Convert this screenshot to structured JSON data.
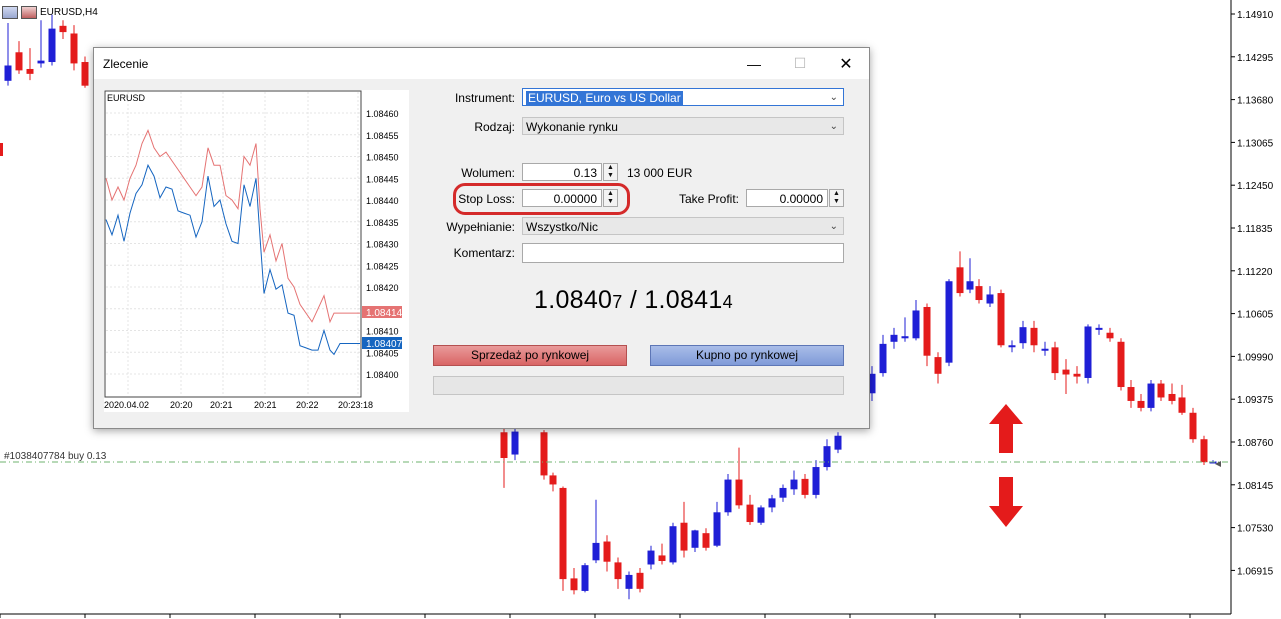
{
  "main_chart": {
    "symbol_label": "EURUSD,H4",
    "order_line_label": "#1038407784 buy 0.13",
    "price_ticks": [
      "1.14910",
      "1.14295",
      "1.13680",
      "1.13065",
      "1.12450",
      "1.11835",
      "1.11220",
      "1.10605",
      "1.09990",
      "1.09375",
      "1.08760",
      "1.08145",
      "1.07530",
      "1.06915"
    ],
    "colors": {
      "bull": "#1f1fd6",
      "bear": "#e41b1b",
      "order_line": "#6fb36f"
    },
    "up_arrow_icon": "arrow-up-icon",
    "down_arrow_icon": "arrow-down-icon"
  },
  "dialog": {
    "title": "Zlecenie",
    "minimize_icon": "minimize-icon",
    "maximize_icon": "maximize-icon",
    "close_icon": "close-icon",
    "mini_chart": {
      "symbol": "EURUSD",
      "price_ticks": [
        "1.08460",
        "1.08455",
        "1.08450",
        "1.08445",
        "1.08440",
        "1.08435",
        "1.08430",
        "1.08425",
        "1.08420",
        "1.08415",
        "1.08410",
        "1.08405",
        "1.08400"
      ],
      "time_ticks": [
        "2020.04.02",
        "20:20",
        "20:21",
        "20:21",
        "20:22",
        "20:23:18"
      ],
      "ask_label": "1.08414",
      "bid_label": "1.08407",
      "colors": {
        "ask": "#e57373",
        "bid": "#1565c0"
      }
    },
    "instrument_label": "Instrument:",
    "instrument_value": "EURUSD, Euro vs US Dollar",
    "type_label": "Rodzaj:",
    "type_value": "Wykonanie rynku",
    "volume_label": "Wolumen:",
    "volume_value": "0.13",
    "volume_note": "13 000 EUR",
    "stop_loss_label": "Stop Loss:",
    "stop_loss_value": "0.00000",
    "take_profit_label": "Take Profit:",
    "take_profit_value": "0.00000",
    "fill_label": "Wypełnianie:",
    "fill_value": "Wszystko/Nic",
    "comment_label": "Komentarz:",
    "comment_value": "",
    "bid_main": "1.0840",
    "bid_small": "7",
    "separator": " / ",
    "ask_main": "1.0841",
    "ask_small": "4",
    "sell_button": "Sprzedaż po rynkowej",
    "buy_button": "Kupno po rynkowej"
  }
}
